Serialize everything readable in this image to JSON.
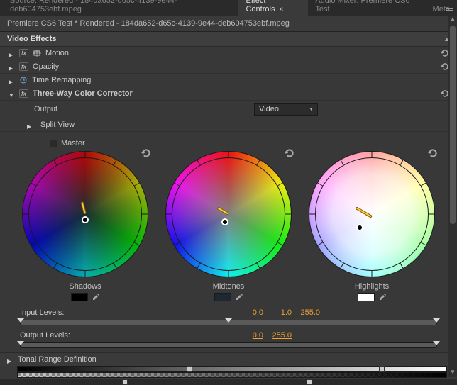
{
  "tabs": {
    "t0": "Source: Rendered - 184da652-d65c-4139-9e44-deb604753ebf.mpeg",
    "t1": "Effect Controls",
    "t2": "Audio Mixer: Premiere CS6 Test",
    "t3": "Meta"
  },
  "pathbar": "Premiere CS6 Test * Rendered - 184da652-d65c-4139-9e44-deb604753ebf.mpeg",
  "section_video_effects": "Video Effects",
  "fx_motion": "Motion",
  "fx_opacity": "Opacity",
  "fx_time_remap": "Time Remapping",
  "fx_threeway": "Three-Way Color Corrector",
  "param_output": "Output",
  "param_output_value": "Video",
  "param_splitview": "Split View",
  "master_label": "Master",
  "wheel_shadows": "Shadows",
  "wheel_midtones": "Midtones",
  "wheel_highlights": "Highlights",
  "input_levels_label": "Input Levels:",
  "input_levels": {
    "black": "0.0",
    "gamma": "1.0",
    "white": "255.0"
  },
  "output_levels_label": "Output Levels:",
  "output_levels": {
    "black": "0.0",
    "white": "255.0"
  },
  "tonal_range_label": "Tonal Range Definition",
  "swatches": {
    "shadows": "#000000",
    "midtones": "#1e2833",
    "highlights": "#ffffff"
  }
}
